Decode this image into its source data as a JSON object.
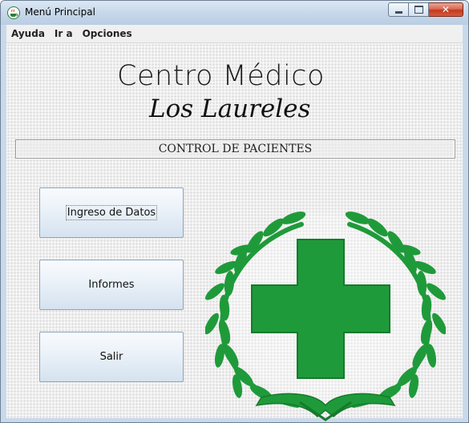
{
  "window": {
    "title": "Menú Principal",
    "app_icon": "java-cup-icon",
    "controls": {
      "minimize": "minimize-icon",
      "maximize": "maximize-icon",
      "close": "close-icon",
      "close_glyph": "✕"
    }
  },
  "menubar": {
    "items": [
      {
        "label": "Ayuda"
      },
      {
        "label": "Ir a"
      },
      {
        "label": "Opciones"
      }
    ]
  },
  "brand": {
    "line1": "Centro Médico",
    "line2": "Los Laureles"
  },
  "section": {
    "title": "CONTROL DE PACIENTES"
  },
  "buttons": {
    "data_entry": "Ingreso de Datos",
    "reports": "Informes",
    "exit": "Salir"
  },
  "emblem": {
    "icon": "green-cross-laurel-icon",
    "color": "#1f9a3a",
    "dark_color": "#167a2c"
  },
  "colors": {
    "titlebar": "#c7d8ea",
    "close_button": "#c3391f",
    "button_border": "#8ea4bd"
  }
}
